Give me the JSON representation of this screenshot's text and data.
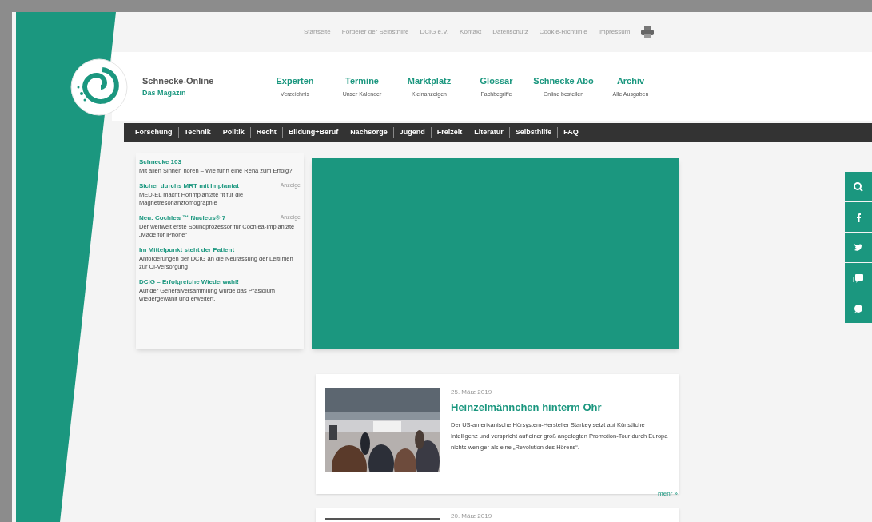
{
  "top_links": [
    "Startseite",
    "Förderer der Selbsthilfe",
    "DCIG e.V.",
    "Kontakt",
    "Datenschutz",
    "Cookie-Richtlinie",
    "Impressum"
  ],
  "brand": {
    "title": "Schnecke-Online",
    "subtitle": "Das Magazin"
  },
  "main_menu": [
    {
      "label": "Experten",
      "sub": "Verzeichnis"
    },
    {
      "label": "Termine",
      "sub": "Unser Kalender"
    },
    {
      "label": "Marktplatz",
      "sub": "Kleinanzeigen"
    },
    {
      "label": "Glossar",
      "sub": "Fachbegriffe"
    },
    {
      "label": "Schnecke Abo",
      "sub": "Online bestellen"
    },
    {
      "label": "Archiv",
      "sub": "Alle Ausgaben"
    }
  ],
  "nav": [
    "Forschung",
    "Technik",
    "Politik",
    "Recht",
    "Bildung+Beruf",
    "Nachsorge",
    "Jugend",
    "Freizeit",
    "Literatur",
    "Selbsthilfe",
    "FAQ"
  ],
  "teasers": [
    {
      "title": "Schnecke 103",
      "text": "Mit allen Sinnen hören – Wie führt eine Reha zum Erfolg?"
    },
    {
      "title": "Sicher durchs MRT mit Implantat",
      "badge": "Anzeige",
      "text": "MED-EL macht Hörimplantate fit für die Magnetresonanztomographie"
    },
    {
      "title": "Neu: Cochlear™ Nucleus® 7",
      "badge": "Anzeige",
      "text": "Der weltweit erste Soundprozessor für Cochlea-Implantate „Made for iPhone“"
    },
    {
      "title": "Im Mittelpunkt steht der Patient",
      "text": "Anforderungen der DCIG an die Neufassung der Leitlinien zur CI-Versorgung"
    },
    {
      "title": "DCIG – Erfolgreiche Wiederwahl!",
      "text": "Auf der Generalversammlung wurde das Präsidium wiedergewählt und erweitert."
    }
  ],
  "articles": [
    {
      "date": "25. März 2019",
      "title": "Heinzelmännchen hinterm Ohr",
      "text": "Der US-amerikanische Hörsystem-Hersteller Starkey setzt auf Künstliche Intelligenz und verspricht auf einer groß angelegten Promotion-Tour durch Europa nichts weniger als eine „Revolution des Hörens“.",
      "more": "mehr »"
    },
    {
      "date": "20. März 2019"
    }
  ]
}
